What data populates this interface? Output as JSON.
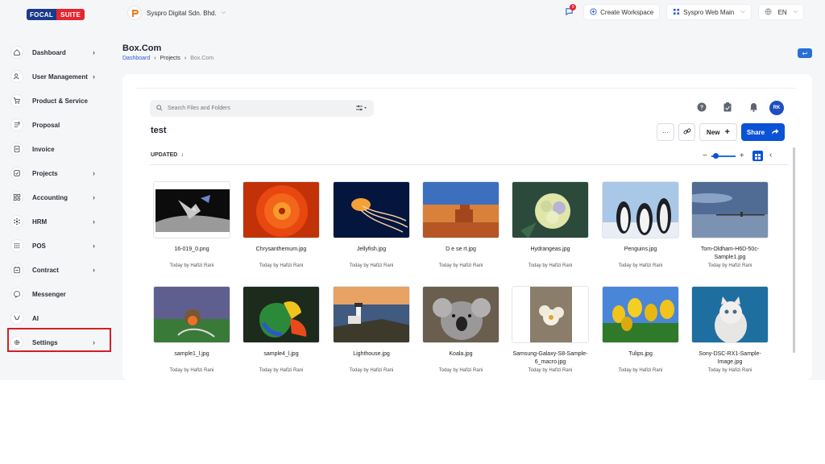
{
  "brand": {
    "part1": "FOCAL",
    "part2": "SUITE"
  },
  "company": {
    "name": "Syspro Digital Sdn. Bhd."
  },
  "topbar": {
    "notif_count": "9",
    "create_workspace": "Create Workspace",
    "workspace": "Syspro Web Main",
    "language": "EN"
  },
  "sidebar": {
    "items": [
      {
        "label": "Dashboard",
        "icon": "home-icon",
        "arrow": true
      },
      {
        "label": "User Management",
        "icon": "users-icon",
        "arrow": true
      },
      {
        "label": "Product & Service",
        "icon": "cart-icon",
        "arrow": false
      },
      {
        "label": "Proposal",
        "icon": "proposal-icon",
        "arrow": false
      },
      {
        "label": "Invoice",
        "icon": "invoice-icon",
        "arrow": false
      },
      {
        "label": "Projects",
        "icon": "projects-icon",
        "arrow": true
      },
      {
        "label": "Accounting",
        "icon": "accounting-icon",
        "arrow": true
      },
      {
        "label": "HRM",
        "icon": "hrm-icon",
        "arrow": true
      },
      {
        "label": "POS",
        "icon": "pos-icon",
        "arrow": true
      },
      {
        "label": "Contract",
        "icon": "contract-icon",
        "arrow": true
      },
      {
        "label": "Messenger",
        "icon": "messenger-icon",
        "arrow": false
      },
      {
        "label": "AI",
        "icon": "ai-icon",
        "arrow": false
      },
      {
        "label": "Settings",
        "icon": "gear-icon",
        "arrow": true
      }
    ]
  },
  "page": {
    "title": "Box.Com",
    "breadcrumb": {
      "dashboard": "Dashboard",
      "projects": "Projects",
      "current": "Box.Com"
    }
  },
  "toolbar": {
    "search_placeholder": "Search Files and Folders",
    "avatar": "RK",
    "folder": "test",
    "more": "···",
    "new_label": "New",
    "share_label": "Share",
    "sort_label": "UPDATED"
  },
  "files": [
    {
      "name": "16-019_0.png",
      "meta": "Today by Hafizi Rani",
      "art": "space"
    },
    {
      "name": "Chrysanthemum.jpg",
      "meta": "Today by Hafizi Rani",
      "art": "flower"
    },
    {
      "name": "Jellyfish.jpg",
      "meta": "Today by Hafizi Rani",
      "art": "jelly"
    },
    {
      "name": "D e se rt.jpg",
      "meta": "Today by Hafizi Rani",
      "art": "desert"
    },
    {
      "name": "Hydrangeas.jpg",
      "meta": "Today by Hafizi Rani",
      "art": "hydrangea"
    },
    {
      "name": "Penguins.jpg",
      "meta": "Today by Hafizi Rani",
      "art": "penguins"
    },
    {
      "name": "Tom-Oldham-H6D-50c-Sample1.jpg",
      "meta": "Today by Hafizi Rani",
      "art": "pier"
    },
    {
      "name": "sample1_l.jpg",
      "meta": "Today by Hafizi Rani",
      "art": "robin"
    },
    {
      "name": "sample4_l.jpg",
      "meta": "Today by Hafizi Rani",
      "art": "parrot"
    },
    {
      "name": "Lighthouse.jpg",
      "meta": "Today by Hafizi Rani",
      "art": "lighthouse"
    },
    {
      "name": "Koala.jpg",
      "meta": "Today by Hafizi Rani",
      "art": "koala"
    },
    {
      "name": "Samsung-Galaxy-S8-Sample-6_macro.jpg",
      "meta": "Today by Hafizi Rani",
      "art": "macro"
    },
    {
      "name": "Tulips.jpg",
      "meta": "Today by Hafizi Rani",
      "art": "tulips"
    },
    {
      "name": "Sony-DSC-RX1-Sample-Image.jpg",
      "meta": "Today by Hafizi Rani",
      "art": "cat"
    }
  ],
  "colors": {
    "brand_blue": "#1b3a8a",
    "brand_red": "#e3262f",
    "primary": "#0a52d6",
    "highlight": "#d21f26"
  }
}
